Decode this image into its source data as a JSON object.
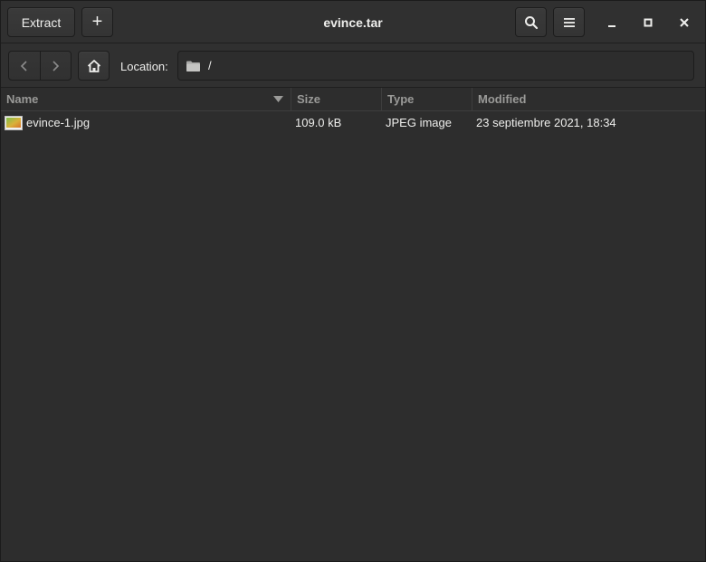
{
  "header": {
    "extract_label": "Extract",
    "add_label": "+",
    "title": "evince.tar",
    "search_icon": "search-icon",
    "menu_icon": "hamburger-menu-icon"
  },
  "location": {
    "label": "Location:",
    "path": "/",
    "folder_icon": "folder-icon"
  },
  "columns": {
    "name": "Name",
    "size": "Size",
    "type": "Type",
    "modified": "Modified"
  },
  "files": [
    {
      "name": "evince-1.jpg",
      "size": "109.0 kB",
      "type": "JPEG image",
      "modified": "23 septiembre 2021, 18:34",
      "icon": "image-file-icon"
    }
  ],
  "colors": {
    "background": "#2d2d2d",
    "headerbar": "#303030",
    "text": "#eeeeec",
    "dim_text": "#9a9a98"
  }
}
